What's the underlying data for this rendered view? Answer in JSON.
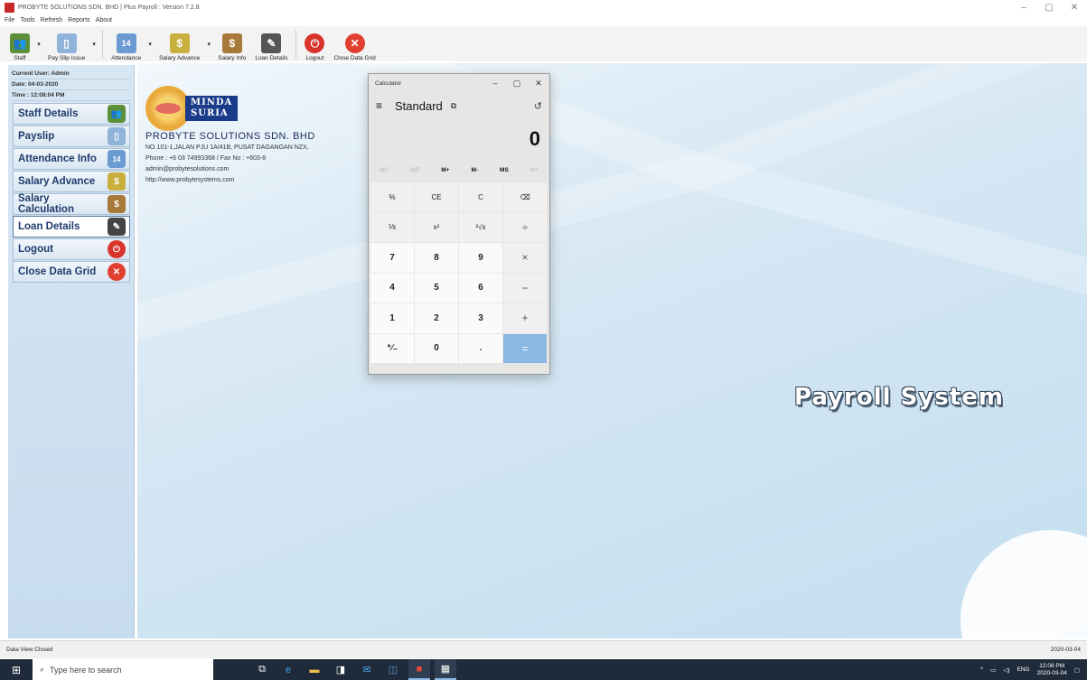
{
  "window": {
    "title": "PROBYTE SOLUTIONS SDN. BHD | Plus Payroll : Version 7.2.8",
    "controls": [
      "–",
      "▢",
      "✕"
    ]
  },
  "menu": [
    "File",
    "Tools",
    "Refresh",
    "Reports",
    "About"
  ],
  "toolbar": {
    "buttons": [
      {
        "label": "Staff",
        "icon": "staff-icon",
        "color": "#5b8f3a",
        "glyph": "👥"
      },
      {
        "label": "Pay Slip Issue",
        "icon": "payslip-icon",
        "color": "#8fb3d9",
        "glyph": "▯"
      },
      {
        "label": "Attendance",
        "icon": "calendar-icon",
        "color": "#6c9bd2",
        "glyph": "14"
      },
      {
        "label": "Salary Advance",
        "icon": "money-icon",
        "color": "#c9b03e",
        "glyph": "$"
      },
      {
        "label": "Salary Info",
        "icon": "moneybag-icon",
        "color": "#a77a3c",
        "glyph": "$"
      },
      {
        "label": "Loan Details",
        "icon": "document-icon",
        "color": "#555555",
        "glyph": "✎"
      },
      {
        "label": "Logout",
        "icon": "power-icon",
        "color": "#d9342b",
        "glyph": "⏻"
      },
      {
        "label": "Close Data Grid",
        "icon": "close-circle-icon",
        "color": "#e0402f",
        "glyph": "✕"
      }
    ],
    "dropdown_glyph": "▾"
  },
  "user_info": {
    "current_user": "Current User: Admin",
    "date": "Date: 04-03-2020",
    "time": "Time : 12:08:04 PM"
  },
  "nav": [
    {
      "label": "Staff Details",
      "color": "#5b8f3a",
      "glyph": "👥"
    },
    {
      "label": "Payslip",
      "color": "#8fb3d9",
      "glyph": "▯"
    },
    {
      "label": "Attendance Info",
      "color": "#6c9bd2",
      "glyph": "14"
    },
    {
      "label": "Salary Advance",
      "color": "#c9b03e",
      "glyph": "$"
    },
    {
      "label": "Salary Calculation",
      "color": "#a77a3c",
      "glyph": "$"
    },
    {
      "label": "Loan Details",
      "color": "#444444",
      "glyph": "✎"
    },
    {
      "label": "Logout",
      "color": "#d9342b",
      "glyph": "⏻"
    },
    {
      "label": "Close Data Grid",
      "color": "#e0402f",
      "glyph": "✕"
    }
  ],
  "company": {
    "logo_line1": "MINDA",
    "logo_line2": "SURIA",
    "name": "PROBYTE SOLUTIONS SDN. BHD",
    "address": "NO.101-1,JALAN PJU 1A/41B, PUSAT DAGANGAN NZX,",
    "phone": "Phone : +6 03 74993368 / Fax No : +603-8",
    "email": "admin@probytesolutions.com",
    "website": "http://www.probytesystems.com"
  },
  "banner": "Payroll System",
  "calculator": {
    "title": "Calculator",
    "mode": "Standard",
    "display": "0",
    "memory": [
      "MC",
      "MR",
      "M+",
      "M-",
      "MS",
      "M˅"
    ],
    "keys": [
      "%",
      "CE",
      "C",
      "⌫",
      "⅟x",
      "x²",
      "²√x",
      "÷",
      "7",
      "8",
      "9",
      "×",
      "4",
      "5",
      "6",
      "−",
      "1",
      "2",
      "3",
      "+",
      "⁺∕₋",
      "0",
      ".",
      "="
    ]
  },
  "status": {
    "left": "Data View Closed",
    "right": "2020-03-04"
  },
  "taskbar": {
    "search_placeholder": "Type here to search",
    "lang": "ENG",
    "time": "12:08 PM",
    "date": "2020-03-04"
  }
}
